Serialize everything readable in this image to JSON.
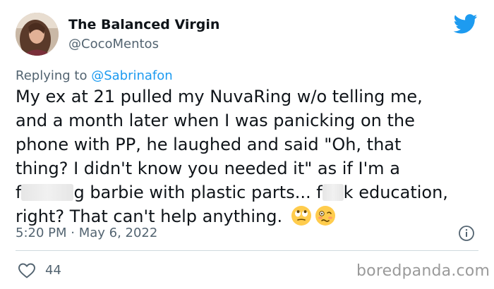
{
  "tweet": {
    "author": {
      "display_name": "The Balanced Virgin",
      "handle": "@CocoMentos",
      "avatar_icon": "profile-photo"
    },
    "platform_icon": "twitter-bird-icon",
    "brand_color": "#1d9bf0",
    "reply_prefix": "Replying to ",
    "reply_to": "@Sabrinafon",
    "text_lines": [
      "My ex at 21 pulled my NuvaRing w/o telling me,",
      "and a month later when I was panicking on the",
      "phone with PP, he laughed and said \"Oh, that",
      "thing? I didn't know you needed it\" as if I'm a"
    ],
    "line5": {
      "part1": "f",
      "part2": "g barbie with plastic parts... f",
      "part3": "k education,"
    },
    "line6": "right? That can't help anything.",
    "emojis": [
      "face-with-rolling-eyes-emoji",
      "woozy-face-emoji"
    ],
    "timestamp": "5:20 PM · May 6, 2022",
    "like_count": "44"
  },
  "watermark": "boredpanda.com"
}
